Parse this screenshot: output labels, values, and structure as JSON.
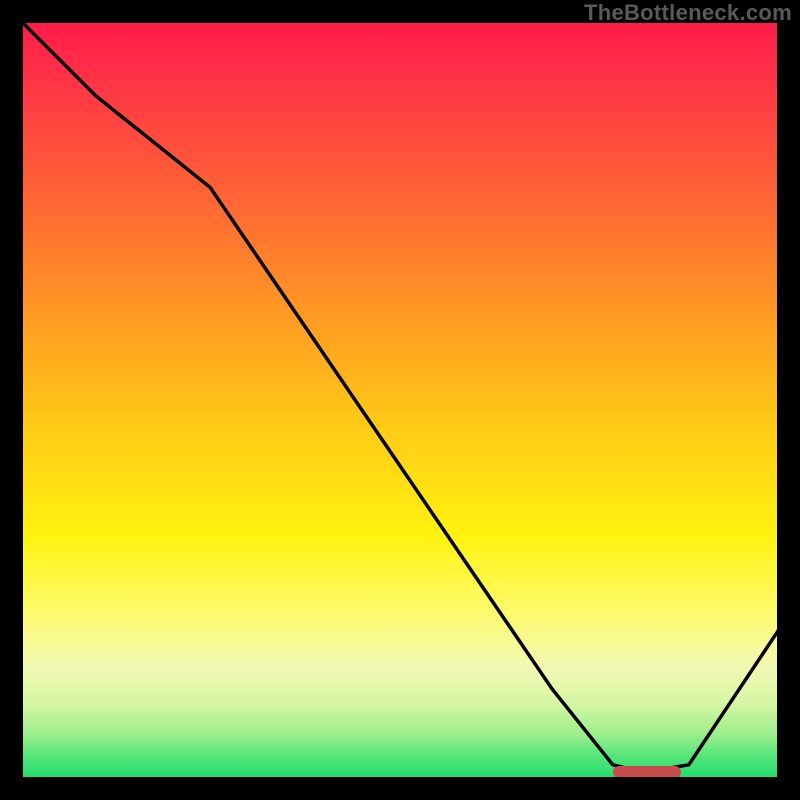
{
  "watermark": "TheBottleneck.com",
  "chart_data": {
    "type": "line",
    "title": "",
    "xlabel": "",
    "ylabel": "",
    "xlim": [
      0,
      100
    ],
    "ylim": [
      0,
      100
    ],
    "grid": false,
    "legend": false,
    "background_gradient": {
      "direction": "vertical",
      "stops": [
        {
          "pos": 0.0,
          "color": "#ff1a4b"
        },
        {
          "pos": 0.25,
          "color": "#ff6a33"
        },
        {
          "pos": 0.55,
          "color": "#ffcf15"
        },
        {
          "pos": 0.78,
          "color": "#fdfb6e"
        },
        {
          "pos": 0.94,
          "color": "#9aee8c"
        },
        {
          "pos": 1.0,
          "color": "#1ddc6a"
        }
      ]
    },
    "series": [
      {
        "name": "bottleneck-curve",
        "x": [
          0,
          10,
          25,
          40,
          55,
          70,
          78,
          82,
          88,
          100
        ],
        "y": [
          100,
          90,
          78,
          56,
          34,
          12,
          2,
          1,
          2,
          20
        ]
      }
    ],
    "optimal_range": {
      "x_start": 78,
      "x_end": 87,
      "y": 0.5
    }
  },
  "colors": {
    "curve": "#000000",
    "marker": "#c94b4b",
    "frame": "#000000"
  }
}
